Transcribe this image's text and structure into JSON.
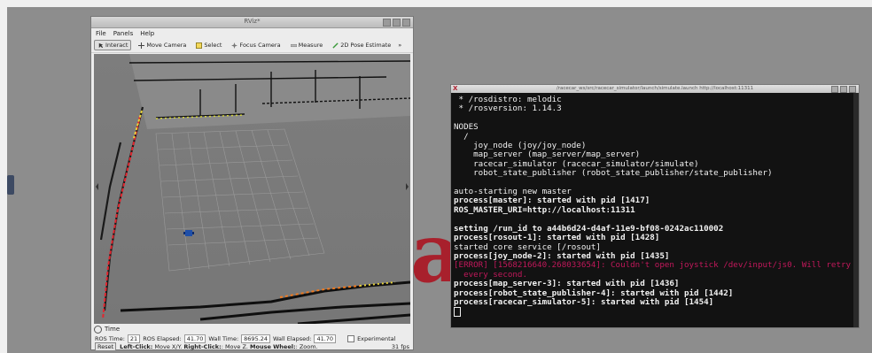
{
  "rviz": {
    "title": "RViz*",
    "menu": [
      "File",
      "Panels",
      "Help"
    ],
    "tools": [
      {
        "label": "Interact",
        "icon": "interact-icon",
        "active": true
      },
      {
        "label": "Move Camera",
        "icon": "move-camera-icon"
      },
      {
        "label": "Select",
        "icon": "select-icon"
      },
      {
        "label": "Focus Camera",
        "icon": "focus-camera-icon"
      },
      {
        "label": "Measure",
        "icon": "measure-icon"
      },
      {
        "label": "2D Pose Estimate",
        "icon": "pose-estimate-icon"
      }
    ],
    "more_tools": "»",
    "time_panel": {
      "title": "Time",
      "ros_time_label": "ROS Time:",
      "ros_time_value": "21",
      "ros_elapsed_label": "ROS Elapsed:",
      "ros_elapsed_value": "41.70",
      "wall_time_label": "Wall Time:",
      "wall_time_value": "8695.24",
      "wall_elapsed_label": "Wall Elapsed:",
      "wall_elapsed_value": "41.70",
      "experimental_label": "Experimental"
    },
    "status": {
      "reset_label": "Reset",
      "hint_left_key": "Left-Click:",
      "hint_left": " Move X/Y. ",
      "hint_right_key": "Right-Click:",
      "hint_right": ": Move Z. ",
      "hint_wheel_key": "Mouse Wheel:",
      "hint_wheel": ": Zoom.",
      "fps": "31 fps"
    }
  },
  "terminal": {
    "title": "/racecar_ws/src/racecar_simulator/launch/simulate.launch http://localhost:11311",
    "lines": [
      {
        "text": " * /rosdistro: melodic",
        "style": ""
      },
      {
        "text": " * /rosversion: 1.14.3",
        "style": ""
      },
      {
        "text": "",
        "style": ""
      },
      {
        "text": "NODES",
        "style": ""
      },
      {
        "text": "  /",
        "style": ""
      },
      {
        "text": "    joy_node (joy/joy_node)",
        "style": ""
      },
      {
        "text": "    map_server (map_server/map_server)",
        "style": ""
      },
      {
        "text": "    racecar_simulator (racecar_simulator/simulate)",
        "style": ""
      },
      {
        "text": "    robot_state_publisher (robot_state_publisher/state_publisher)",
        "style": ""
      },
      {
        "text": "",
        "style": ""
      },
      {
        "text": "auto-starting new master",
        "style": ""
      },
      {
        "text": "process[master]: started with pid [1417]",
        "style": "bold"
      },
      {
        "text": "ROS_MASTER_URI=http://localhost:11311",
        "style": "bold"
      },
      {
        "text": "",
        "style": ""
      },
      {
        "text": "setting /run_id to a44b6d24-d4af-11e9-bf08-0242ac110002",
        "style": "bold"
      },
      {
        "text": "process[rosout-1]: started with pid [1428]",
        "style": "bold"
      },
      {
        "text": "started core service [/rosout]",
        "style": ""
      },
      {
        "text": "process[joy_node-2]: started with pid [1435]",
        "style": "bold"
      },
      {
        "text": "[ERROR] [1568216640.268033654]: Couldn't open joystick /dev/input/js0. Will retry",
        "style": "err"
      },
      {
        "text": "  every second.",
        "style": "err"
      },
      {
        "text": "process[map_server-3]: started with pid [1436]",
        "style": "bold"
      },
      {
        "text": "process[robot_state_publisher-4]: started with pid [1442]",
        "style": "bold"
      },
      {
        "text": "process[racecar_simulator-5]: started with pid [1454]",
        "style": "bold"
      }
    ]
  },
  "background_letter": "a",
  "colors": {
    "terminal_bg": "#121212",
    "error_text": "#c2185b",
    "map_background": "#5f5f5f",
    "robot": "#1f4fa8"
  }
}
